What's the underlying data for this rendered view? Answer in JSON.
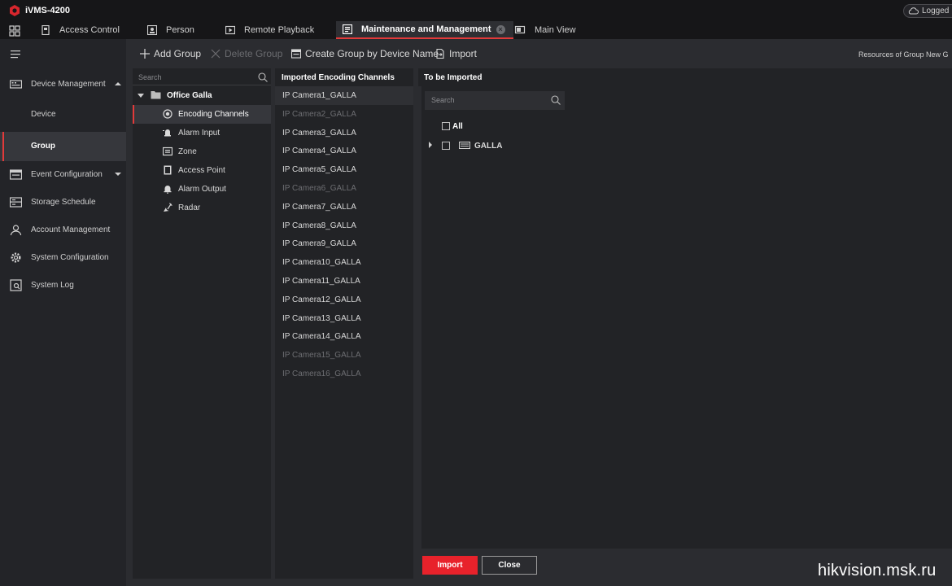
{
  "app": {
    "title": "iVMS-4200",
    "login_status": "Logged In"
  },
  "tabs": [
    {
      "label": "Access Control",
      "icon": "door-icon"
    },
    {
      "label": "Person",
      "icon": "person-card-icon"
    },
    {
      "label": "Remote Playback",
      "icon": "playback-icon"
    },
    {
      "label": "Maintenance and Management",
      "icon": "maintenance-icon",
      "active": true
    },
    {
      "label": "Main View",
      "icon": "main-view-icon"
    }
  ],
  "sidebar": {
    "items": [
      {
        "label": "Device Management",
        "icon": "device-management-icon",
        "expanded": true
      },
      {
        "label": "Device"
      },
      {
        "label": "Group",
        "active": true
      },
      {
        "label": "Event Configuration",
        "icon": "event-config-icon"
      },
      {
        "label": "Storage Schedule",
        "icon": "storage-icon"
      },
      {
        "label": "Account Management",
        "icon": "account-icon"
      },
      {
        "label": "System Configuration",
        "icon": "gear-icon"
      },
      {
        "label": "System Log",
        "icon": "log-icon"
      }
    ]
  },
  "toolbar": {
    "add_group": "Add Group",
    "delete_group": "Delete Group",
    "create_group_by_device": "Create Group by Device Name",
    "import": "Import",
    "resources_text": "Resources of Group New G"
  },
  "tree": {
    "search_placeholder": "Search",
    "root": "Office Galla",
    "items": [
      {
        "label": "Encoding Channels",
        "active": true
      },
      {
        "label": "Alarm Input"
      },
      {
        "label": "Zone"
      },
      {
        "label": "Access Point"
      },
      {
        "label": "Alarm Output"
      },
      {
        "label": "Radar"
      }
    ]
  },
  "imported": {
    "header": "Imported Encoding Channels",
    "channels": [
      {
        "name": "IP Camera1_GALLA",
        "online": true
      },
      {
        "name": "IP Camera2_GALLA",
        "online": false
      },
      {
        "name": "IP Camera3_GALLA",
        "online": true
      },
      {
        "name": "IP Camera4_GALLA",
        "online": true
      },
      {
        "name": "IP Camera5_GALLA",
        "online": true
      },
      {
        "name": "IP Camera6_GALLA",
        "online": false
      },
      {
        "name": "IP Camera7_GALLA",
        "online": true
      },
      {
        "name": "IP Camera8_GALLA",
        "online": true
      },
      {
        "name": "IP Camera9_GALLA",
        "online": true
      },
      {
        "name": "IP Camera10_GALLA",
        "online": true
      },
      {
        "name": "IP Camera11_GALLA",
        "online": true
      },
      {
        "name": "IP Camera12_GALLA",
        "online": true
      },
      {
        "name": "IP Camera13_GALLA",
        "online": true
      },
      {
        "name": "IP Camera14_GALLA",
        "online": true
      },
      {
        "name": "IP Camera15_GALLA",
        "online": false
      },
      {
        "name": "IP Camera16_GALLA",
        "online": false
      }
    ]
  },
  "to_import": {
    "header": "To be Imported",
    "search_placeholder": "Search",
    "all_label": "All",
    "device": "GALLA",
    "import_button": "Import",
    "close_button": "Close"
  },
  "watermark": "hikvision.msk.ru",
  "colors": {
    "accent": "#e23a3a",
    "import_button": "#e8222b"
  }
}
